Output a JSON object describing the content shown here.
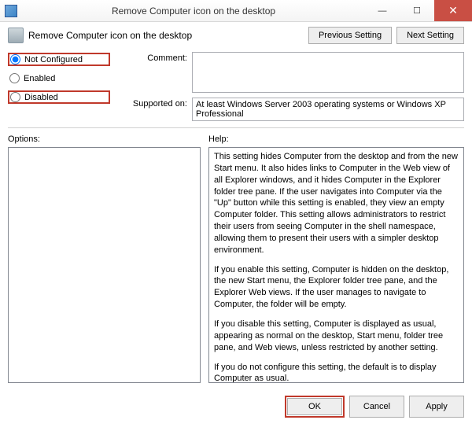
{
  "window": {
    "title": "Remove Computer icon on the desktop",
    "minimize": "—",
    "maximize": "☐",
    "close": "✕"
  },
  "header": {
    "title": "Remove Computer icon on the desktop",
    "previous": "Previous Setting",
    "next": "Next Setting"
  },
  "radios": {
    "not_configured": "Not Configured",
    "enabled": "Enabled",
    "disabled": "Disabled"
  },
  "form": {
    "comment_label": "Comment:",
    "comment_value": "",
    "supported_label": "Supported on:",
    "supported_value": "At least Windows Server 2003 operating systems or Windows XP Professional"
  },
  "options_label": "Options:",
  "help_label": "Help:",
  "help_text": {
    "p1": "This setting hides Computer from the desktop and from the new Start menu. It also hides links to Computer in the Web view of all Explorer windows, and it hides Computer in the Explorer folder tree pane. If the user navigates into Computer via the \"Up\" button while this setting is enabled, they view an empty Computer folder. This setting allows administrators to restrict their users from seeing Computer in the shell namespace, allowing them to present their users with a simpler desktop environment.",
    "p2": "If you enable this setting, Computer is hidden on the desktop, the new Start menu, the Explorer folder tree pane, and the Explorer Web views. If the user manages to navigate to Computer, the folder will be empty.",
    "p3": "If you disable this setting, Computer is displayed as usual, appearing as normal on the desktop, Start menu, folder tree pane, and Web views, unless restricted by another setting.",
    "p4": "If you do not configure this setting, the default is to display Computer as usual."
  },
  "footer": {
    "ok": "OK",
    "cancel": "Cancel",
    "apply": "Apply"
  }
}
